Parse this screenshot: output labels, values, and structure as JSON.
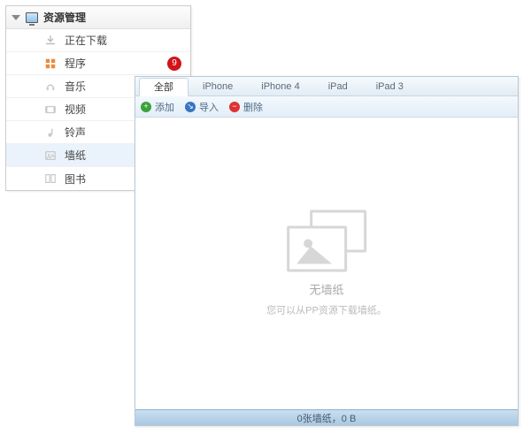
{
  "sidebar": {
    "title": "资源管理",
    "items": [
      {
        "label": "正在下载",
        "icon": "download-icon"
      },
      {
        "label": "程序",
        "icon": "app-icon",
        "badge": "9"
      },
      {
        "label": "音乐",
        "icon": "music-icon"
      },
      {
        "label": "视频",
        "icon": "video-icon"
      },
      {
        "label": "铃声",
        "icon": "ringtone-icon"
      },
      {
        "label": "墙纸",
        "icon": "wallpaper-icon",
        "selected": true
      },
      {
        "label": "图书",
        "icon": "book-icon"
      }
    ]
  },
  "main": {
    "tabs": [
      {
        "label": "全部",
        "active": true
      },
      {
        "label": "iPhone"
      },
      {
        "label": "iPhone 4"
      },
      {
        "label": "iPad"
      },
      {
        "label": "iPad 3"
      }
    ],
    "toolbar": {
      "add": "添加",
      "import": "导入",
      "delete": "删除"
    },
    "empty": {
      "title": "无墙纸",
      "subtitle": "您可以从PP资源下载墙纸。"
    },
    "status": "0张墙纸，0 B"
  }
}
